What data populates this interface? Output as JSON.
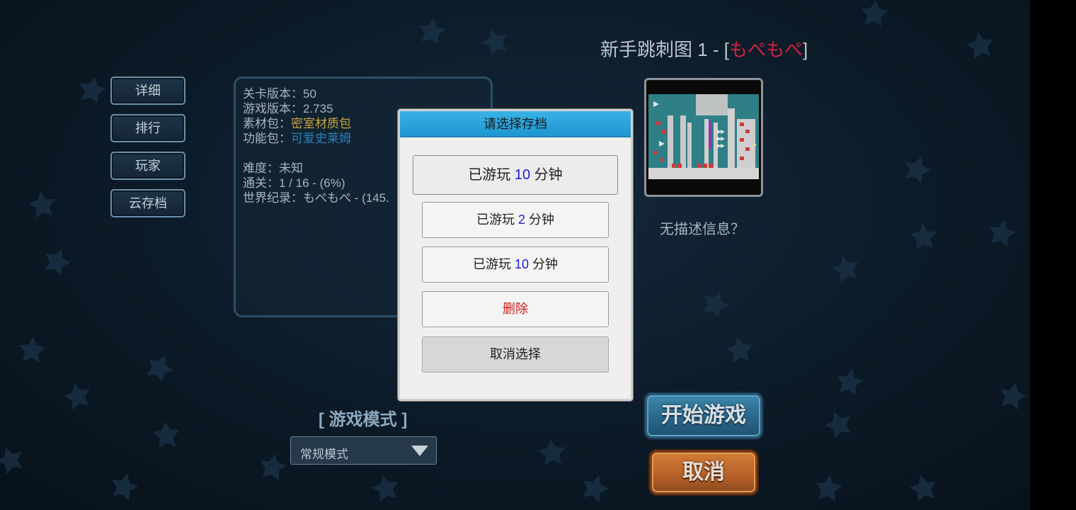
{
  "side_menu": [
    {
      "label": "详细"
    },
    {
      "label": "排行"
    },
    {
      "label": "玩家"
    },
    {
      "label": "云存档"
    }
  ],
  "level": {
    "title_prefix": "新手跳刺图 1 - [",
    "author": "もぺもぺ",
    "title_suffix": "]",
    "no_description": "无描述信息？"
  },
  "info": {
    "level_version_label": "关卡版本：",
    "level_version": "50",
    "game_version_label": "游戏版本：",
    "game_version": "2.735",
    "asset_pack_label": "素材包：",
    "asset_pack": "密室材质包",
    "feature_pack_label": "功能包：",
    "feature_pack": "可爱史莱姆",
    "difficulty_label": "难度：",
    "difficulty": "未知",
    "clear_label": "通关：",
    "clear": "1 / 16 - (6%)",
    "record_label": "世界纪录：",
    "record": "もぺもぺ - (145."
  },
  "mode": {
    "label": "[ 游戏模式 ]",
    "selected": "常规模式"
  },
  "buttons": {
    "start": "开始游戏",
    "cancel": "取消"
  },
  "dialog": {
    "title": "请选择存档",
    "saves": [
      {
        "prefix": "已游玩 ",
        "minutes": "10",
        "suffix": " 分钟"
      },
      {
        "prefix": "已游玩 ",
        "minutes": "2",
        "suffix": " 分钟"
      },
      {
        "prefix": "已游玩 ",
        "minutes": "10",
        "suffix": " 分钟"
      }
    ],
    "delete": "删除",
    "cancel_select": "取消选择"
  },
  "colors": {
    "author": "#d0223f",
    "asset_pack": "#c9a43a",
    "feature_pack": "#2c7fb8",
    "dialog_header": "#2aa6dd",
    "minutes": "#1b1bd6",
    "delete": "#d11a1a"
  }
}
